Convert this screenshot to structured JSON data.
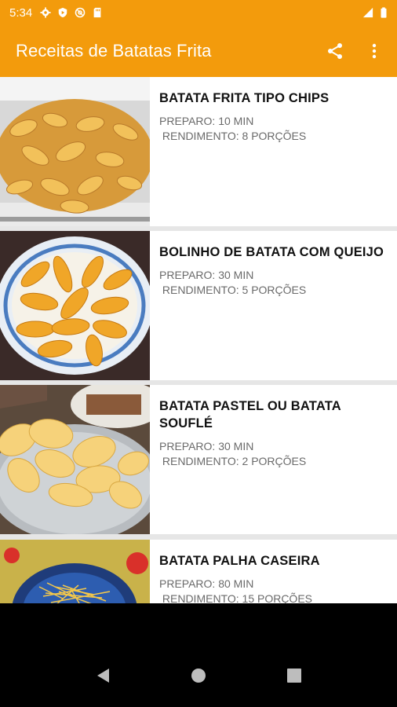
{
  "status_bar": {
    "time": "5:34",
    "left_icons": [
      "gear-icon",
      "shield-icon",
      "at-sign-icon",
      "sd-card-icon"
    ],
    "right_icons": [
      "signal-icon",
      "battery-icon"
    ]
  },
  "app_bar": {
    "title": "Receitas de Batatas Frita",
    "actions": [
      "share-icon",
      "more-vert-icon"
    ]
  },
  "recipes": [
    {
      "title": "BATATA FRITA TIPO CHIPS",
      "preparo": "PREPARO: 10 MIN",
      "rendimento": " RENDIMENTO: 8 PORÇÕES"
    },
    {
      "title": "BOLINHO DE BATATA COM QUEIJO",
      "preparo": "PREPARO: 30 MIN",
      "rendimento": " RENDIMENTO: 5 PORÇÕES"
    },
    {
      "title": "BATATA PASTEL OU BATATA SOUFLÉ",
      "preparo": "PREPARO: 30 MIN",
      "rendimento": " RENDIMENTO: 2 PORÇÕES"
    },
    {
      "title": "BATATA PALHA CASEIRA",
      "preparo": "PREPARO: 80 MIN",
      "rendimento": " RENDIMENTO: 15 PORÇÕES"
    }
  ],
  "nav_bar": {
    "buttons": [
      "back-icon",
      "home-icon",
      "recents-icon"
    ]
  },
  "colors": {
    "accent": "#f39b0c",
    "title_text": "#111111",
    "meta_text": "#6a6a6a"
  }
}
